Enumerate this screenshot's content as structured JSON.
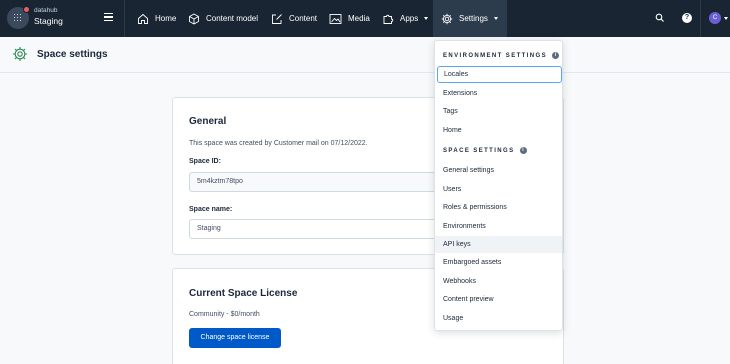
{
  "topbar": {
    "org_name": "datahub",
    "space_name": "Staging",
    "nav": {
      "home": "Home",
      "content_model": "Content model",
      "content": "Content",
      "media": "Media",
      "apps": "Apps",
      "settings": "Settings"
    },
    "user_initial": "C"
  },
  "subheader": {
    "title": "Space settings"
  },
  "general": {
    "heading": "General",
    "created_text": "This space was created by Customer mail on 07/12/2022.",
    "space_id_label": "Space ID:",
    "space_id_value": "5m4kztm78tpo",
    "space_name_label": "Space name:",
    "space_name_value": "Staging"
  },
  "license": {
    "heading": "Current Space License",
    "plan": "Community - $0/month",
    "change_button": "Change space license"
  },
  "dropdown": {
    "env_heading": "ENVIRONMENT SETTINGS",
    "env_items": [
      "Locales",
      "Extensions",
      "Tags",
      "Home"
    ],
    "space_heading": "SPACE SETTINGS",
    "space_items": [
      "General settings",
      "Users",
      "Roles & permissions",
      "Environments",
      "API keys",
      "Embargoed assets",
      "Webhooks",
      "Content preview",
      "Usage"
    ],
    "info_glyph": "i"
  },
  "help_glyph": "?"
}
